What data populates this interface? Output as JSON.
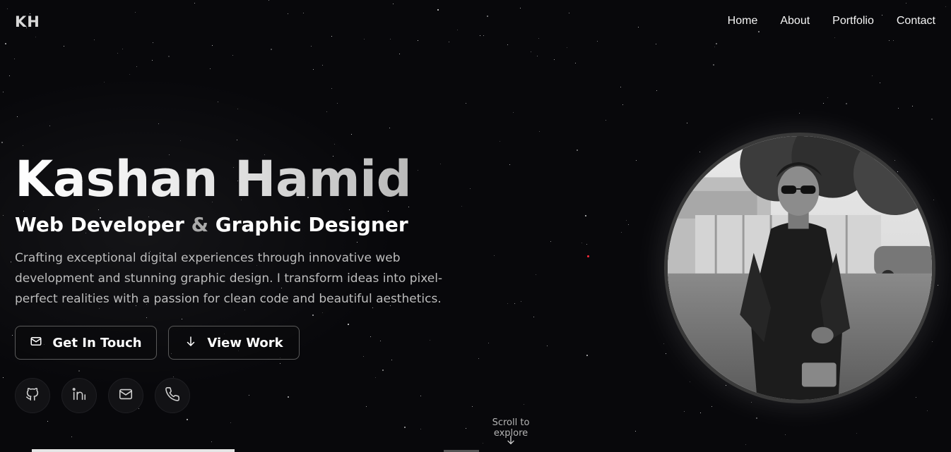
{
  "header": {
    "logo": "KH",
    "nav": [
      {
        "label": "Home"
      },
      {
        "label": "About"
      },
      {
        "label": "Portfolio"
      },
      {
        "label": "Contact"
      }
    ]
  },
  "hero": {
    "name": "Kashan Hamid",
    "role_part1": "Web Developer",
    "role_amp": "&",
    "role_part2": "Graphic Designer",
    "description": "Crafting exceptional digital experiences through innovative web development and stunning graphic design. I transform ideas into pixel-perfect realities with a passion for clean code and beautiful aesthetics.",
    "buttons": {
      "primary": {
        "label": "Get In Touch",
        "icon": "mail-icon"
      },
      "secondary": {
        "label": "View Work",
        "icon": "arrow-down-icon"
      }
    },
    "socials": [
      {
        "icon": "github-icon"
      },
      {
        "icon": "linkedin-icon"
      },
      {
        "icon": "mail-icon"
      },
      {
        "icon": "phone-icon"
      }
    ],
    "scroll_hint": "Scroll to explore"
  },
  "colors": {
    "background": "#08080b",
    "text": "#ffffff",
    "muted_text": "#bdbdbd",
    "border": "#5b5b5b",
    "accent_dot": "#ff2a3a"
  }
}
